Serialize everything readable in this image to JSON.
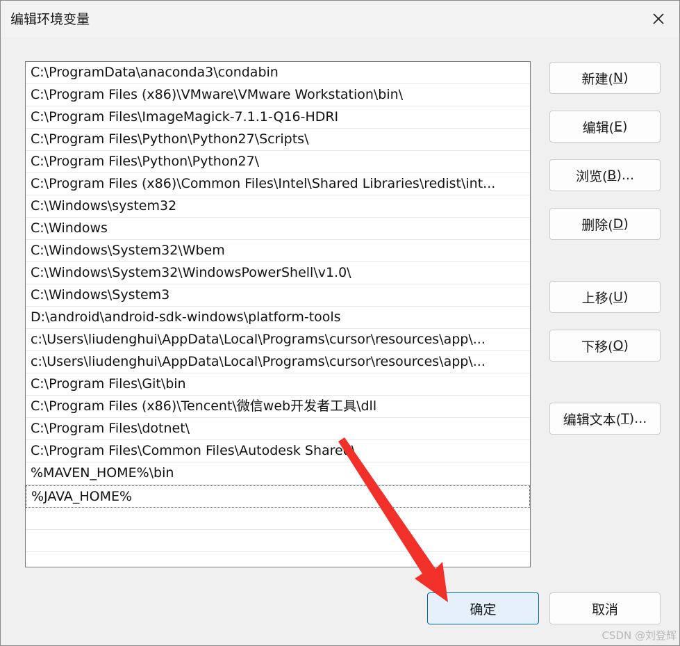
{
  "window": {
    "title": "编辑环境变量"
  },
  "paths": [
    "C:\\ProgramData\\anaconda3\\condabin",
    "C:\\Program Files (x86)\\VMware\\VMware Workstation\\bin\\",
    "C:\\Program Files\\ImageMagick-7.1.1-Q16-HDRI",
    "C:\\Program Files\\Python\\Python27\\Scripts\\",
    "C:\\Program Files\\Python\\Python27\\",
    "C:\\Program Files (x86)\\Common Files\\Intel\\Shared Libraries\\redist\\int...",
    "C:\\Windows\\system32",
    "C:\\Windows",
    "C:\\Windows\\System32\\Wbem",
    "C:\\Windows\\System32\\WindowsPowerShell\\v1.0\\",
    "C:\\Windows\\System3",
    "D:\\android\\android-sdk-windows\\platform-tools",
    "c:\\Users\\liudenghui\\AppData\\Local\\Programs\\cursor\\resources\\app\\...",
    "c:\\Users\\liudenghui\\AppData\\Local\\Programs\\cursor\\resources\\app\\...",
    "C:\\Program Files\\Git\\bin",
    "C:\\Program Files (x86)\\Tencent\\微信web开发者工具\\dll",
    "C:\\Program Files\\dotnet\\",
    "C:\\Program Files\\Common Files\\Autodesk Shared\\",
    "%MAVEN_HOME%\\bin",
    "%JAVA_HOME%"
  ],
  "buttons": {
    "new": {
      "label": "新建(",
      "key": "N",
      "suffix": ")"
    },
    "edit": {
      "label": "编辑(",
      "key": "E",
      "suffix": ")"
    },
    "browse": {
      "label": "浏览(",
      "key": "B",
      "suffix": ")..."
    },
    "delete": {
      "label": "删除(",
      "key": "D",
      "suffix": ")"
    },
    "move_up": {
      "label": "上移(",
      "key": "U",
      "suffix": ")"
    },
    "move_down": {
      "label": "下移(",
      "key": "O",
      "suffix": ")"
    },
    "edit_text": {
      "label": "编辑文本(",
      "key": "T",
      "suffix": ")..."
    },
    "ok": "确定",
    "cancel": "取消"
  },
  "watermark": "CSDN @刘登辉",
  "annotation": {
    "arrow_color": "#f2302a"
  },
  "icons": {
    "close": "close-icon"
  }
}
